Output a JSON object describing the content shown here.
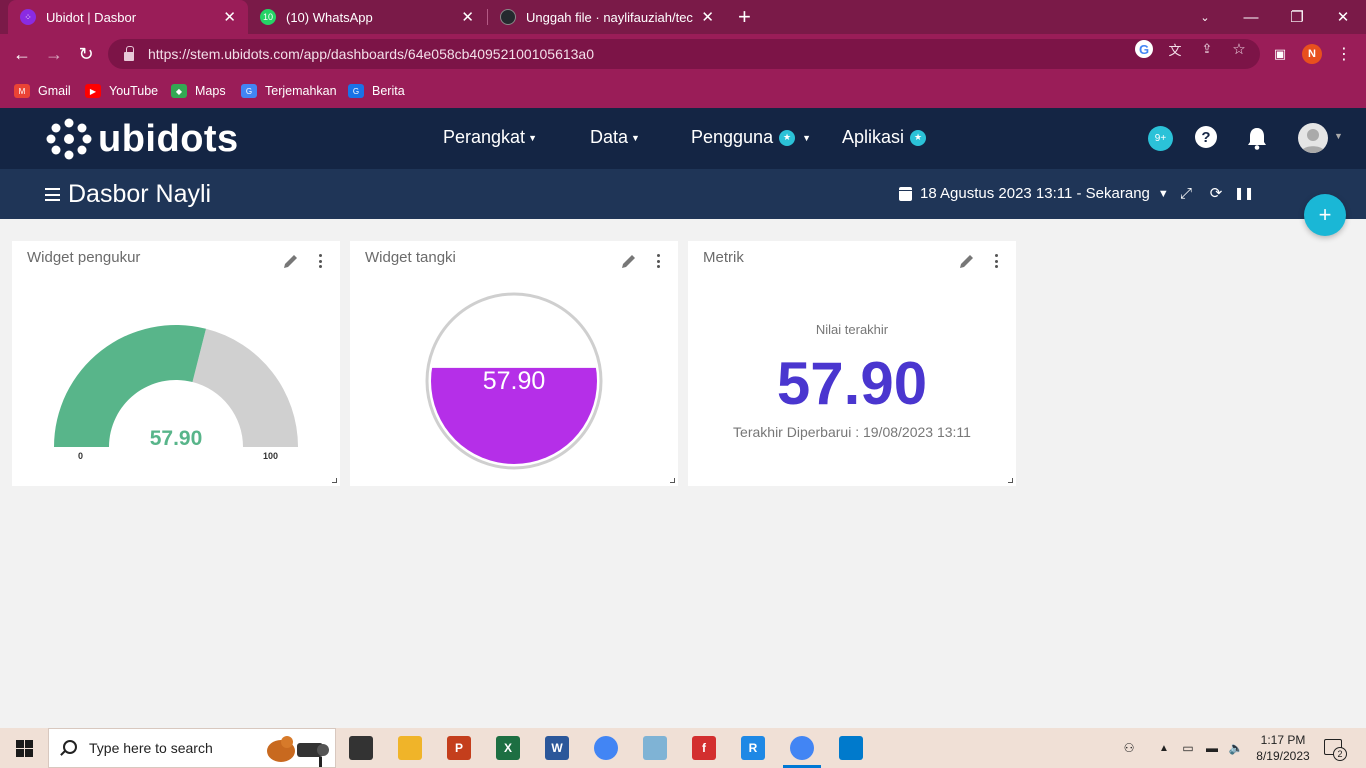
{
  "browser": {
    "tabs": [
      {
        "title": "Ubidot | Dasbor",
        "active": true
      },
      {
        "title": "(10) WhatsApp",
        "badge": "10",
        "active": false
      },
      {
        "title": "Unggah file · naylifauziah/technic",
        "active": false
      }
    ],
    "new_tab_label": "+",
    "url": "https://stem.ubidots.com/app/dashboards/64e058cb40952100105613a0",
    "profile_initial": "N",
    "bookmarks": [
      {
        "label": "Gmail",
        "icon": "gmail-icon",
        "color": "#ea4335"
      },
      {
        "label": "YouTube",
        "icon": "youtube-icon",
        "color": "#ff0000"
      },
      {
        "label": "Maps",
        "icon": "maps-icon",
        "color": "#34a853"
      },
      {
        "label": "Terjemahkan",
        "icon": "translate-icon",
        "color": "#4285f4"
      },
      {
        "label": "Berita",
        "icon": "news-icon",
        "color": "#1a73e8"
      }
    ]
  },
  "ubidots": {
    "logo_text": "ubidots",
    "menu": [
      {
        "label": "Perangkat",
        "caret": true,
        "star": false
      },
      {
        "label": "Data",
        "caret": true,
        "star": false
      },
      {
        "label": "Pengguna",
        "caret": true,
        "star": true
      },
      {
        "label": "Aplikasi",
        "caret": false,
        "star": true
      }
    ],
    "notifications_badge": "9+",
    "help_label": "?"
  },
  "dashboard": {
    "title": "Dasbor Nayli",
    "date_range": "18 Agustus 2023 13:11 - Sekarang",
    "add_widget_label": "+"
  },
  "widgets": {
    "gauge": {
      "title": "Widget pengukur",
      "value": "57.90",
      "numeric_value": 57.9,
      "min_label": "0",
      "max_label": "100",
      "fill_color": "#58b58a",
      "track_color": "#d0d0d0"
    },
    "tank": {
      "title": "Widget tangki",
      "value": "57.90",
      "fill_fraction": 0.579,
      "fill_color": "#b52fe8"
    },
    "metric": {
      "title": "Metrik",
      "label": "Nilai terakhir",
      "value": "57.90",
      "updated": "Terakhir Diperbarui : 19/08/2023 13:11",
      "value_color": "#4a36cf"
    }
  },
  "taskbar": {
    "search_placeholder": "Type here to search",
    "apps": [
      {
        "name": "task-view-icon",
        "label": "",
        "color": "#333333"
      },
      {
        "name": "file-explorer-icon",
        "label": "",
        "color": "#f0b429"
      },
      {
        "name": "powerpoint-icon",
        "label": "P",
        "color": "#c43e1c"
      },
      {
        "name": "excel-icon",
        "label": "X",
        "color": "#1d6f42"
      },
      {
        "name": "word-icon",
        "label": "W",
        "color": "#2b579a"
      },
      {
        "name": "chrome-icon",
        "label": "",
        "color": "#4285f4"
      },
      {
        "name": "notes-app-icon",
        "label": "",
        "color": "#7fb3d5"
      },
      {
        "name": "foxit-icon",
        "label": "f",
        "color": "#d32f2f"
      },
      {
        "name": "rdp-app-icon",
        "label": "R",
        "color": "#1e88e5"
      },
      {
        "name": "chrome-profile-icon",
        "label": "",
        "color": "#4285f4"
      },
      {
        "name": "vscode-icon",
        "label": "",
        "color": "#007acc"
      }
    ],
    "time": "1:17 PM",
    "date": "8/19/2023",
    "notification_count": "2"
  }
}
